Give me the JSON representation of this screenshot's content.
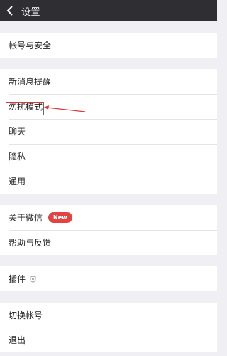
{
  "header": {
    "title": "设置",
    "back_icon": "chevron-left-icon",
    "background": "#2e2e33"
  },
  "groups": [
    {
      "items": [
        {
          "label": "帐号与安全"
        }
      ]
    },
    {
      "items": [
        {
          "label": "新消息提醒"
        },
        {
          "label": "勿扰模式"
        },
        {
          "label": "聊天"
        },
        {
          "label": "隐私"
        },
        {
          "label": "通用"
        }
      ]
    },
    {
      "items": [
        {
          "label": "关于微信",
          "badge": "New"
        },
        {
          "label": "帮助与反馈"
        }
      ]
    },
    {
      "items": [
        {
          "label": "插件",
          "icon": "shield-icon"
        }
      ]
    },
    {
      "items": [
        {
          "label": "切换帐号"
        },
        {
          "label": "退出"
        }
      ]
    }
  ],
  "annotation": {
    "highlighted_item": "勿扰模式",
    "color": "#d73a3a"
  },
  "colors": {
    "badge": "#e64340",
    "page_background": "#efeff4"
  }
}
